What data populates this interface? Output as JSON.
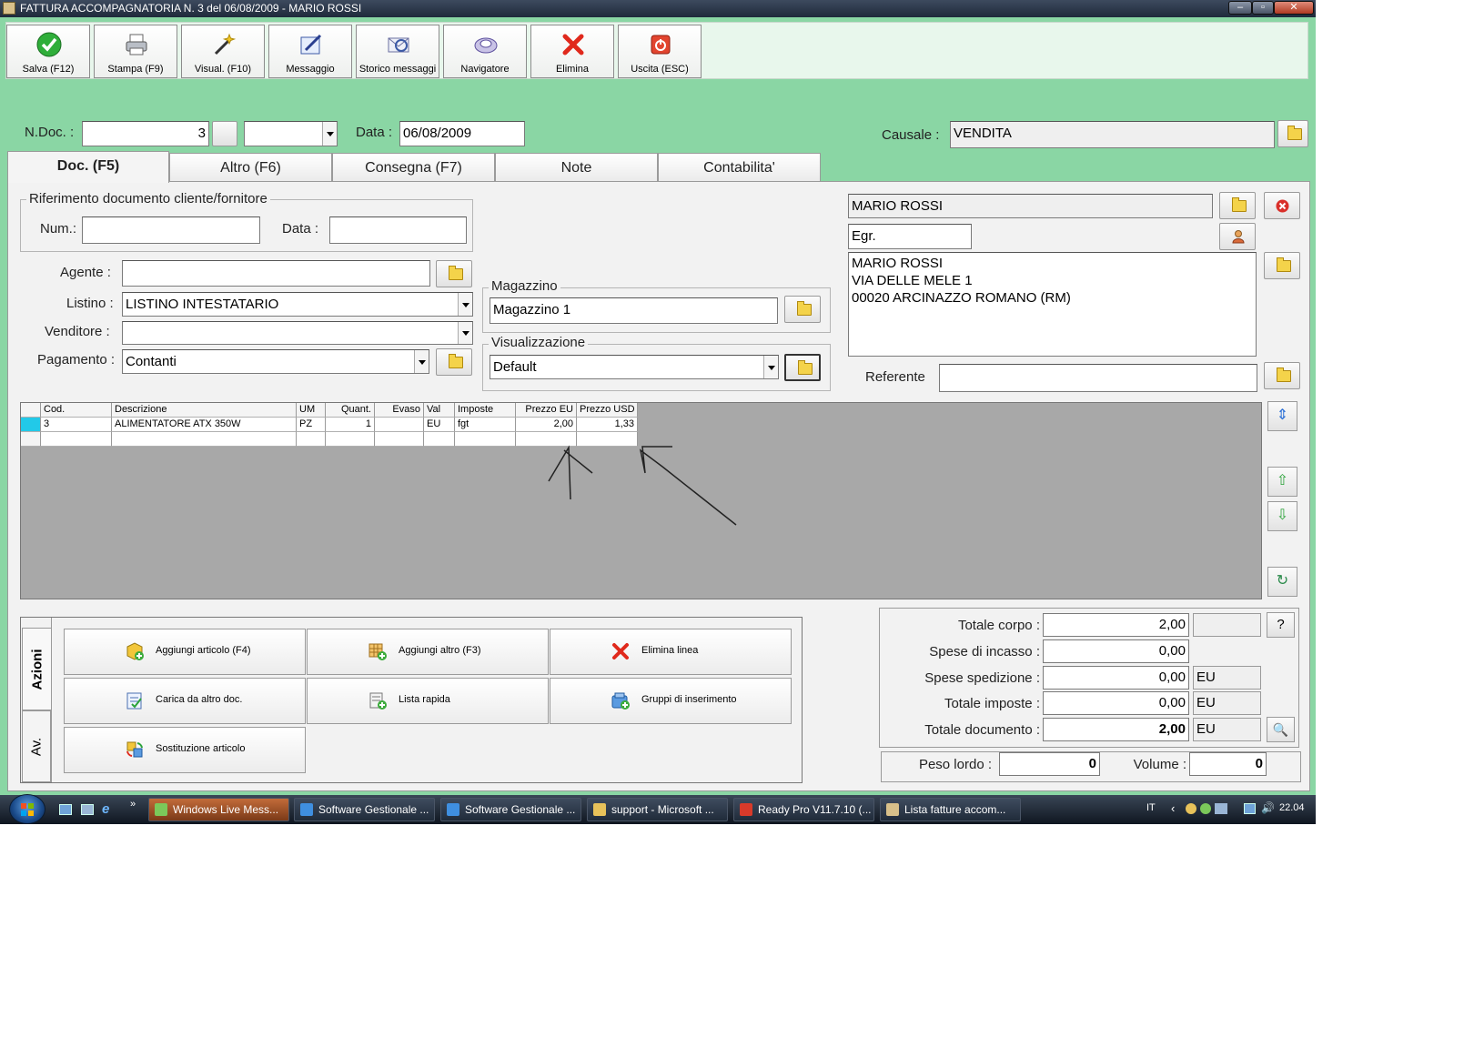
{
  "window": {
    "title": "FATTURA ACCOMPAGNATORIA N. 3  del 06/08/2009 - MARIO ROSSI"
  },
  "toolbar": [
    {
      "label": "Salva (F12)",
      "icon": "check-icon"
    },
    {
      "label": "Stampa (F9)",
      "icon": "printer-icon"
    },
    {
      "label": "Visual. (F10)",
      "icon": "wand-icon"
    },
    {
      "label": "Messaggio",
      "icon": "message-icon"
    },
    {
      "label": "Storico messaggi",
      "icon": "message-history-icon"
    },
    {
      "label": "Navigatore",
      "icon": "navigator-icon"
    },
    {
      "label": "Elimina",
      "icon": "delete-icon"
    },
    {
      "label": "Uscita (ESC)",
      "icon": "exit-icon"
    }
  ],
  "header": {
    "ndoc_label": "N.Doc. :",
    "ndoc_value": "3",
    "data_label": "Data :",
    "data_value": "06/08/2009",
    "causale_label": "Causale :",
    "causale_value": "VENDITA"
  },
  "tabs": [
    "Doc. (F5)",
    "Altro (F6)",
    "Consegna (F7)",
    "Note",
    "Contabilita'"
  ],
  "riferimento": {
    "title": "Riferimento documento cliente/fornitore",
    "num_label": "Num.:",
    "num_value": "",
    "data_label": "Data :",
    "data_value": ""
  },
  "fields": {
    "agente_label": "Agente :",
    "agente_value": "",
    "listino_label": "Listino :",
    "listino_value": "LISTINO INTESTATARIO",
    "venditore_label": "Venditore :",
    "venditore_value": "",
    "pagamento_label": "Pagamento :",
    "pagamento_value": "Contanti"
  },
  "magazzino": {
    "title": "Magazzino",
    "value": "Magazzino 1"
  },
  "visualizzazione": {
    "title": "Visualizzazione",
    "value": "Default"
  },
  "cliente": {
    "name": "MARIO ROSSI",
    "title": "Egr.",
    "address_lines": [
      "MARIO ROSSI",
      "VIA DELLE MELE 1",
      "00020 ARCINAZZO ROMANO (RM)"
    ],
    "referente_label": "Referente",
    "referente_value": ""
  },
  "grid": {
    "columns": [
      "Cod.",
      "Descrizione",
      "UM",
      "Quant.",
      "Evaso",
      "Val",
      "Imposte",
      "Prezzo EU",
      "Prezzo USD"
    ],
    "rows": [
      [
        "3",
        "ALIMENTATORE ATX 350W",
        "PZ",
        "1",
        "",
        "EU",
        "fgt",
        "2,00",
        "1,33"
      ]
    ]
  },
  "actions": {
    "tab_azioni": "Azioni",
    "tab_av": "Av.",
    "buttons": [
      {
        "label": "Aggiungi articolo (F4)",
        "icon": "add-article-icon"
      },
      {
        "label": "Aggiungi altro (F3)",
        "icon": "add-other-icon"
      },
      {
        "label": "Elimina linea",
        "icon": "delete-line-icon"
      },
      {
        "label": "Carica da altro doc.",
        "icon": "load-doc-icon"
      },
      {
        "label": "Lista rapida",
        "icon": "quick-list-icon"
      },
      {
        "label": "Gruppi di inserimento",
        "icon": "insert-groups-icon"
      },
      {
        "label": "Sostituzione articolo",
        "icon": "replace-article-icon"
      }
    ]
  },
  "totals": {
    "totale_corpo_label": "Totale corpo :",
    "totale_corpo_value": "2,00",
    "help_label": "?",
    "spese_incasso_label": "Spese di incasso :",
    "spese_incasso_value": "0,00",
    "spese_spedizione_label": "Spese spedizione :",
    "spese_spedizione_value": "0,00",
    "spese_spedizione_cur": "EU",
    "totale_imposte_label": "Totale imposte :",
    "totale_imposte_value": "0,00",
    "totale_imposte_cur": "EU",
    "totale_documento_label": "Totale documento :",
    "totale_documento_value": "2,00",
    "totale_documento_cur": "EU",
    "peso_label": "Peso lordo :",
    "peso_value": "0",
    "volume_label": "Volume :",
    "volume_value": "0"
  },
  "taskbar": {
    "items": [
      "Windows Live Mess...",
      "Software Gestionale ...",
      "Software Gestionale ...",
      "support - Microsoft ...",
      "Ready Pro V11.7.10 (...",
      "Lista fatture accom..."
    ],
    "lang": "IT",
    "clock": "22.04"
  },
  "colors": {
    "window_bg": "#8ad6a4",
    "panel_bg": "#f2f2f2",
    "grid_bg": "#a8a8a8",
    "taskbar": "#1c2533"
  }
}
